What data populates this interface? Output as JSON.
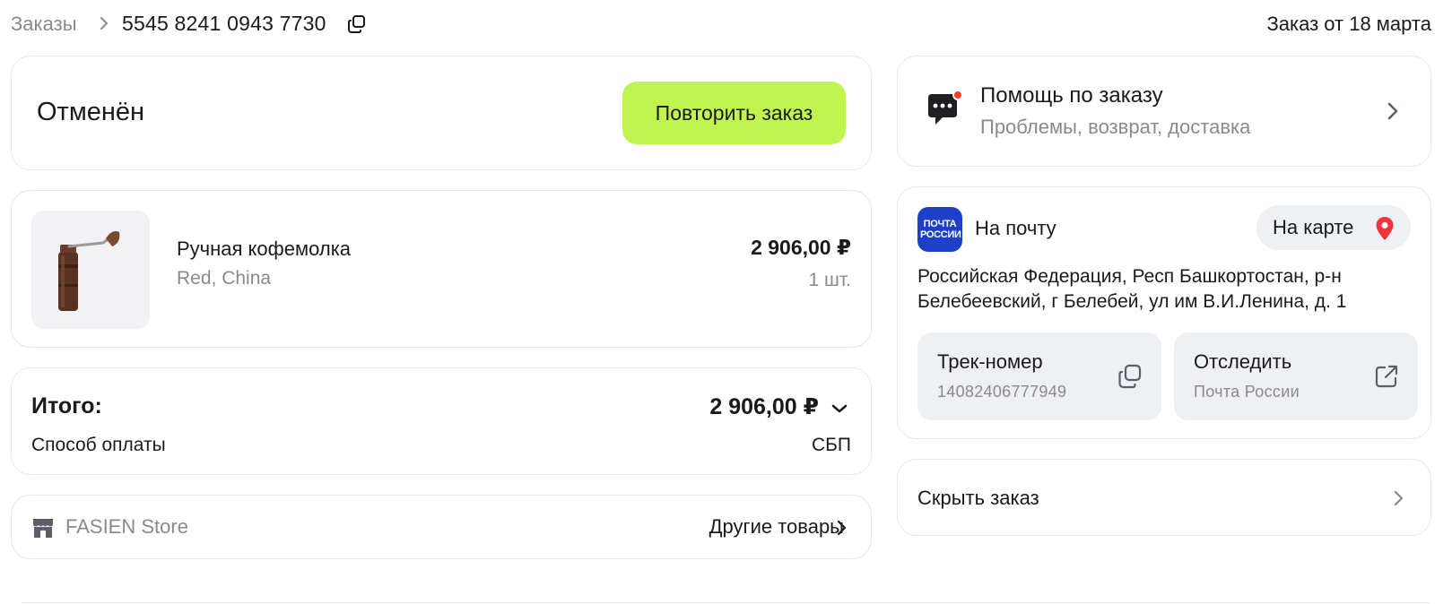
{
  "breadcrumb": {
    "parent": "Заказы",
    "order_number": "5545 8241 0943 7730",
    "order_date": "Заказ от 18 марта"
  },
  "status": {
    "title": "Отменён",
    "repeat_label": "Повторить заказ",
    "accent_color": "#c0f550"
  },
  "item": {
    "name": "Ручная кофемолка",
    "variant": "Red, China",
    "price": "2 906,00 ₽",
    "quantity": "1 шт."
  },
  "totals": {
    "label": "Итого:",
    "value": "2 906,00 ₽",
    "payment_label": "Способ оплаты",
    "payment_value": "СБП"
  },
  "store": {
    "name": "FASIEN Store",
    "link_label": "Другие товары"
  },
  "help": {
    "title": "Помощь по заказу",
    "subtitle": "Проблемы, возврат, доставка"
  },
  "delivery": {
    "logo_text": "ПОЧТА РОССИИ",
    "method": "На почту",
    "map_label": "На карте",
    "address_line1": "Российская Федерация, Респ Башкортостан, р-н",
    "address_line2": "Белебеевский, г Белебей, ул им В.И.Ленина, д. 1",
    "track_title": "Трек-номер",
    "track_number": "14082406777949",
    "trace_title": "Отследить",
    "trace_carrier": "Почта России"
  },
  "hide": {
    "label": "Скрыть заказ"
  }
}
